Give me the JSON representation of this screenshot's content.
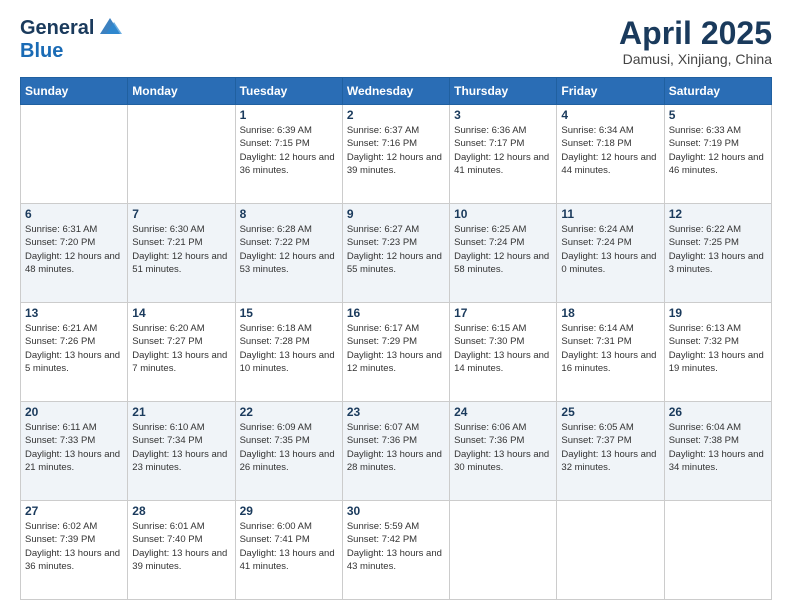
{
  "header": {
    "logo_line1": "General",
    "logo_line2": "Blue",
    "month": "April 2025",
    "location": "Damusi, Xinjiang, China"
  },
  "days_of_week": [
    "Sunday",
    "Monday",
    "Tuesday",
    "Wednesday",
    "Thursday",
    "Friday",
    "Saturday"
  ],
  "weeks": [
    [
      {
        "day": "",
        "info": ""
      },
      {
        "day": "",
        "info": ""
      },
      {
        "day": "1",
        "info": "Sunrise: 6:39 AM\nSunset: 7:15 PM\nDaylight: 12 hours and 36 minutes."
      },
      {
        "day": "2",
        "info": "Sunrise: 6:37 AM\nSunset: 7:16 PM\nDaylight: 12 hours and 39 minutes."
      },
      {
        "day": "3",
        "info": "Sunrise: 6:36 AM\nSunset: 7:17 PM\nDaylight: 12 hours and 41 minutes."
      },
      {
        "day": "4",
        "info": "Sunrise: 6:34 AM\nSunset: 7:18 PM\nDaylight: 12 hours and 44 minutes."
      },
      {
        "day": "5",
        "info": "Sunrise: 6:33 AM\nSunset: 7:19 PM\nDaylight: 12 hours and 46 minutes."
      }
    ],
    [
      {
        "day": "6",
        "info": "Sunrise: 6:31 AM\nSunset: 7:20 PM\nDaylight: 12 hours and 48 minutes."
      },
      {
        "day": "7",
        "info": "Sunrise: 6:30 AM\nSunset: 7:21 PM\nDaylight: 12 hours and 51 minutes."
      },
      {
        "day": "8",
        "info": "Sunrise: 6:28 AM\nSunset: 7:22 PM\nDaylight: 12 hours and 53 minutes."
      },
      {
        "day": "9",
        "info": "Sunrise: 6:27 AM\nSunset: 7:23 PM\nDaylight: 12 hours and 55 minutes."
      },
      {
        "day": "10",
        "info": "Sunrise: 6:25 AM\nSunset: 7:24 PM\nDaylight: 12 hours and 58 minutes."
      },
      {
        "day": "11",
        "info": "Sunrise: 6:24 AM\nSunset: 7:24 PM\nDaylight: 13 hours and 0 minutes."
      },
      {
        "day": "12",
        "info": "Sunrise: 6:22 AM\nSunset: 7:25 PM\nDaylight: 13 hours and 3 minutes."
      }
    ],
    [
      {
        "day": "13",
        "info": "Sunrise: 6:21 AM\nSunset: 7:26 PM\nDaylight: 13 hours and 5 minutes."
      },
      {
        "day": "14",
        "info": "Sunrise: 6:20 AM\nSunset: 7:27 PM\nDaylight: 13 hours and 7 minutes."
      },
      {
        "day": "15",
        "info": "Sunrise: 6:18 AM\nSunset: 7:28 PM\nDaylight: 13 hours and 10 minutes."
      },
      {
        "day": "16",
        "info": "Sunrise: 6:17 AM\nSunset: 7:29 PM\nDaylight: 13 hours and 12 minutes."
      },
      {
        "day": "17",
        "info": "Sunrise: 6:15 AM\nSunset: 7:30 PM\nDaylight: 13 hours and 14 minutes."
      },
      {
        "day": "18",
        "info": "Sunrise: 6:14 AM\nSunset: 7:31 PM\nDaylight: 13 hours and 16 minutes."
      },
      {
        "day": "19",
        "info": "Sunrise: 6:13 AM\nSunset: 7:32 PM\nDaylight: 13 hours and 19 minutes."
      }
    ],
    [
      {
        "day": "20",
        "info": "Sunrise: 6:11 AM\nSunset: 7:33 PM\nDaylight: 13 hours and 21 minutes."
      },
      {
        "day": "21",
        "info": "Sunrise: 6:10 AM\nSunset: 7:34 PM\nDaylight: 13 hours and 23 minutes."
      },
      {
        "day": "22",
        "info": "Sunrise: 6:09 AM\nSunset: 7:35 PM\nDaylight: 13 hours and 26 minutes."
      },
      {
        "day": "23",
        "info": "Sunrise: 6:07 AM\nSunset: 7:36 PM\nDaylight: 13 hours and 28 minutes."
      },
      {
        "day": "24",
        "info": "Sunrise: 6:06 AM\nSunset: 7:36 PM\nDaylight: 13 hours and 30 minutes."
      },
      {
        "day": "25",
        "info": "Sunrise: 6:05 AM\nSunset: 7:37 PM\nDaylight: 13 hours and 32 minutes."
      },
      {
        "day": "26",
        "info": "Sunrise: 6:04 AM\nSunset: 7:38 PM\nDaylight: 13 hours and 34 minutes."
      }
    ],
    [
      {
        "day": "27",
        "info": "Sunrise: 6:02 AM\nSunset: 7:39 PM\nDaylight: 13 hours and 36 minutes."
      },
      {
        "day": "28",
        "info": "Sunrise: 6:01 AM\nSunset: 7:40 PM\nDaylight: 13 hours and 39 minutes."
      },
      {
        "day": "29",
        "info": "Sunrise: 6:00 AM\nSunset: 7:41 PM\nDaylight: 13 hours and 41 minutes."
      },
      {
        "day": "30",
        "info": "Sunrise: 5:59 AM\nSunset: 7:42 PM\nDaylight: 13 hours and 43 minutes."
      },
      {
        "day": "",
        "info": ""
      },
      {
        "day": "",
        "info": ""
      },
      {
        "day": "",
        "info": ""
      }
    ]
  ]
}
